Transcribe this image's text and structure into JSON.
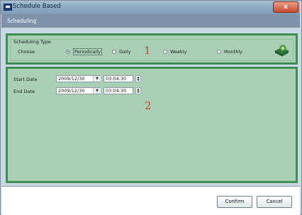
{
  "window": {
    "title": "Schedule Based",
    "close_glyph": "x"
  },
  "header": {
    "title": "Scheduling"
  },
  "scheduling_type": {
    "label": "Scheduling Type",
    "choose_label": "Choose",
    "options": [
      {
        "label": "Periodically",
        "selected": true
      },
      {
        "label": "Daily",
        "selected": false
      },
      {
        "label": "Weekly",
        "selected": false
      },
      {
        "label": "Monthly",
        "selected": false
      }
    ],
    "icon": "setup-gear-icon"
  },
  "annotations": {
    "one": "1",
    "two": "2"
  },
  "dates": {
    "start": {
      "label": "Start Date",
      "date": "2009/12/30",
      "time": "03:04:30"
    },
    "end": {
      "label": "End Date",
      "date": "2009/12/30",
      "time": "03:04:30"
    }
  },
  "buttons": {
    "confirm": "Confirm",
    "cancel": "Cancel"
  },
  "colors": {
    "panel_fill": "#a9d0b5",
    "panel_border": "#3f8f54",
    "annotation": "#d83a2a",
    "header": "#7e93aa"
  }
}
